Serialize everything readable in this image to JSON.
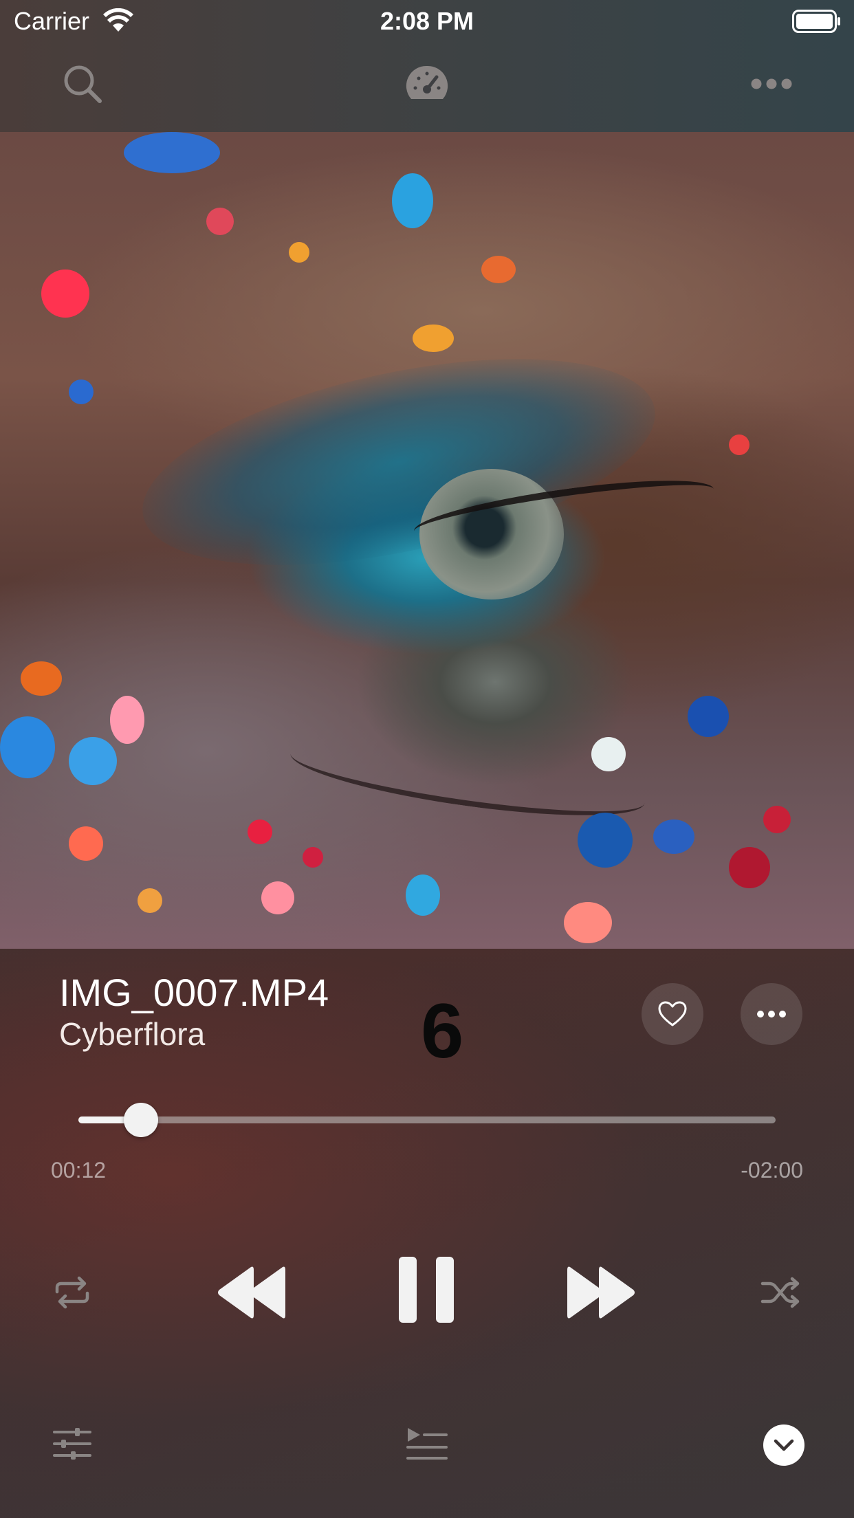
{
  "status_bar": {
    "carrier": "Carrier",
    "time": "2:08 PM"
  },
  "toolbar": {
    "search_icon": "search-icon",
    "speed_icon": "speedometer-icon",
    "more_icon": "ellipsis-icon"
  },
  "track": {
    "title": "IMG_0007.MP4",
    "artist": "Cyberflora",
    "overlay_number": "6",
    "liked": false
  },
  "progress": {
    "elapsed": "00:12",
    "remaining": "-02:00",
    "fraction": 0.09
  },
  "transport": {
    "repeat_icon": "repeat-icon",
    "rewind_icon": "rewind-icon",
    "pause_icon": "pause-icon",
    "forward_icon": "fast-forward-icon",
    "shuffle_icon": "shuffle-icon"
  },
  "bottom_bar": {
    "equalizer_icon": "equalizer-icon",
    "queue_icon": "queue-icon",
    "collapse_icon": "chevron-down-icon"
  },
  "colors": {
    "accent": "#ffffff",
    "muted_icon": "#8a8584"
  }
}
